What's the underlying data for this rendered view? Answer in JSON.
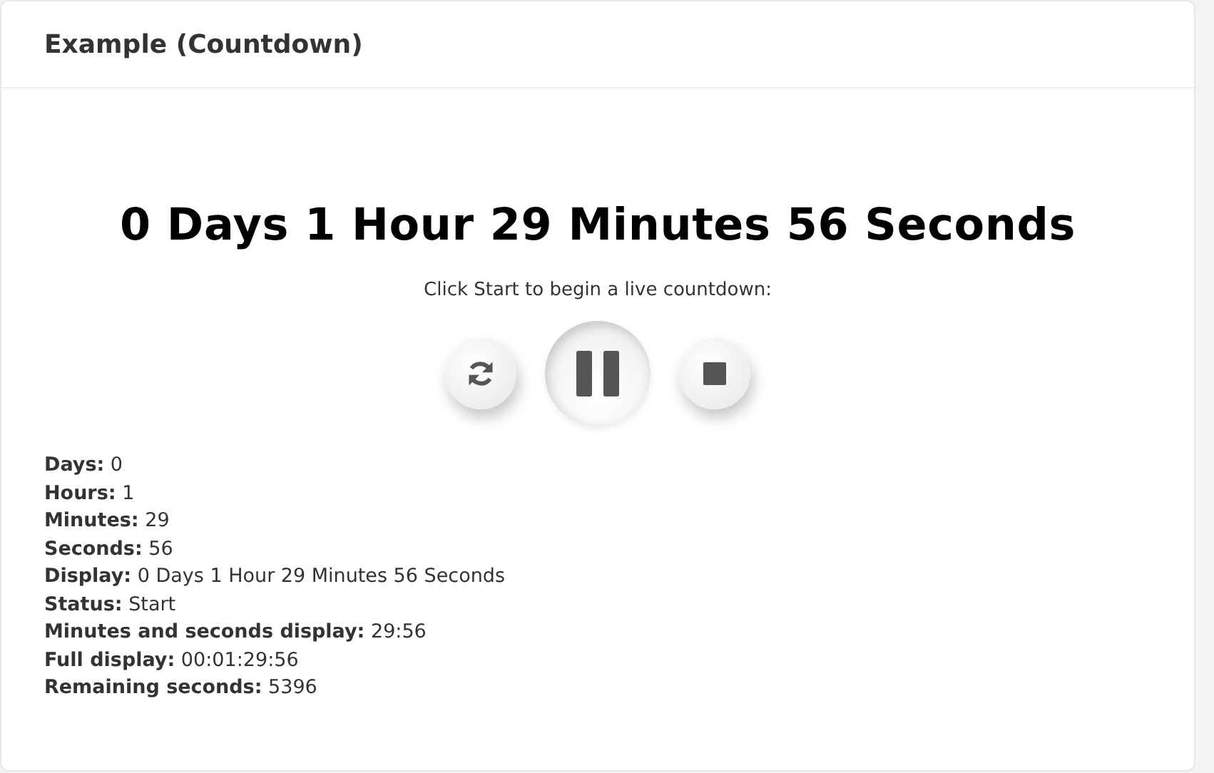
{
  "card": {
    "title": "Example (Countdown)"
  },
  "countdown": {
    "display": "0 Days 1 Hour 29 Minutes 56 Seconds",
    "instruction": "Click Start to begin a live countdown:"
  },
  "controls": [
    {
      "kind": "reset"
    },
    {
      "kind": "pause"
    },
    {
      "kind": "stop"
    }
  ],
  "details": [
    "**Days:** 0",
    "**Hours:** 1",
    "**Minutes:** 29",
    "**Seconds:** 56",
    "**Display:** 0 Days 1 Hour 29 Minutes 56 Seconds",
    "**Status:** Start",
    "**Minutes and seconds display:** 29:56",
    "**Full display:** 00:01:29:56",
    "**Remaining seconds:** 5396"
  ]
}
